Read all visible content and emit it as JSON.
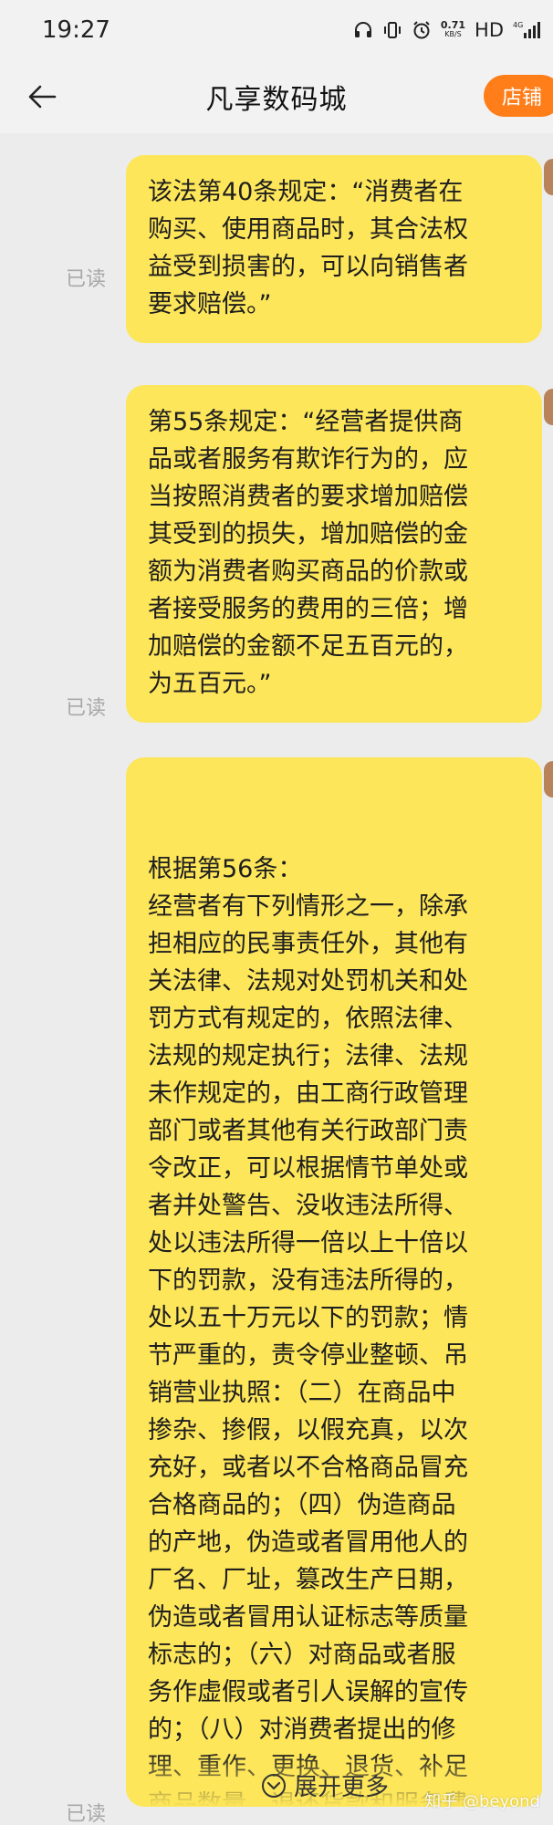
{
  "status_bar": {
    "time": "19:27",
    "speed_value": "0.71",
    "speed_unit": "KB/S",
    "hd": "HD",
    "network": "4G"
  },
  "header": {
    "title": "凡享数码城",
    "shop_button": "店铺"
  },
  "messages": [
    {
      "read_label": "已读",
      "text": "该法第40条规定：“消费者在\n购买、使用商品时，其合法权\n益受到损害的，可以向销售者\n要求赔偿。”"
    },
    {
      "read_label": "已读",
      "text": "第55条规定：“经营者提供商\n品或者服务有欺诈行为的，应\n当按照消费者的要求增加赔偿\n其受到的损失，增加赔偿的金\n额为消费者购买商品的价款或\n者接受服务的费用的三倍；增\n加赔偿的金额不足五百元的，\n为五百元。”"
    },
    {
      "read_label": "已读",
      "text": "根据第56条：\n经营者有下列情形之一，除承\n担相应的民事责任外，其他有\n关法律、法规对处罚机关和处\n罚方式有规定的，依照法律、\n法规的规定执行；法律、法规\n未作规定的，由工商行政管理\n部门或者其他有关行政部门责\n令改正，可以根据情节单处或\n者并处警告、没收违法所得、\n处以违法所得一倍以上十倍以\n下的罚款，没有违法所得的，\n处以五十万元以下的罚款；情\n节严重的，责令停业整顿、吊\n销营业执照：（二）在商品中\n掺杂、掺假，以假充真，以次\n充好，或者以不合格商品冒充\n合格商品的；（四）伪造商品\n的产地，伪造或者冒用他人的\n厂名、厂址，篡改生产日期，\n伪造或者冒用认证标志等质量\n标志的；（六）对商品或者服\n务作虚假或者引人误解的宣传\n的；（八）对消费者提出的修\n理、重作、更换、退货、补足\n商品数量、退还货款和服务费\n用或者赔偿损失的要求，故意"
    }
  ],
  "expand": {
    "label": "展开更多",
    "icon": "chevron-down-circle-icon"
  },
  "watermark": "知乎 @beyond",
  "colors": {
    "bubble": "#fde65a",
    "shop_button": "#ff7e1a",
    "background": "#ececec"
  }
}
